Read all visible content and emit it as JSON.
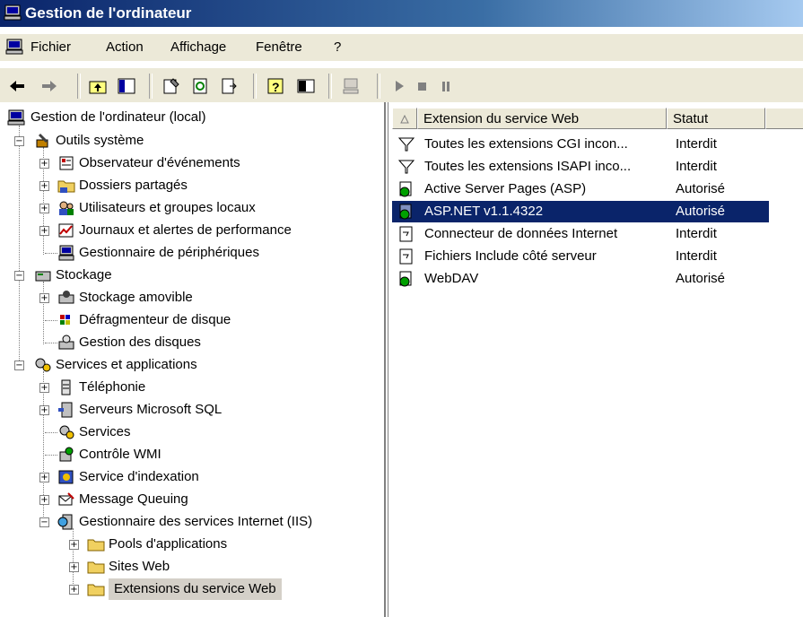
{
  "window": {
    "title": "Gestion de l'ordinateur"
  },
  "menu": [
    {
      "label": "Fichier"
    },
    {
      "label": "Action"
    },
    {
      "label": "Affichage"
    },
    {
      "label": "Fenêtre"
    },
    {
      "label": "?"
    }
  ],
  "tree": {
    "root": "Gestion de l'ordinateur (local)",
    "outils": "Outils système",
    "observateur": "Observateur d'événements",
    "dossiers": "Dossiers partagés",
    "utilisateurs": "Utilisateurs et groupes locaux",
    "journaux": "Journaux et alertes de performance",
    "peripheriques": "Gestionnaire de périphériques",
    "stockage": "Stockage",
    "amovible": "Stockage amovible",
    "defrag": "Défragmenteur de disque",
    "disques": "Gestion des disques",
    "services_apps": "Services et applications",
    "telephonie": "Téléphonie",
    "sql": "Serveurs Microsoft SQL",
    "services": "Services",
    "wmi": "Contrôle WMI",
    "indexation": "Service d'indexation",
    "queuing": "Message Queuing",
    "iis": "Gestionnaire des services Internet (IIS)",
    "pools": "Pools d'applications",
    "sites": "Sites Web",
    "extensions": "Extensions du service Web"
  },
  "list": {
    "columns": [
      "Extension du service Web",
      "Statut"
    ],
    "rows": [
      {
        "name": "Toutes les extensions CGI incon...",
        "status": "Interdit",
        "icon": "filter-icon"
      },
      {
        "name": "Toutes les extensions ISAPI inco...",
        "status": "Interdit",
        "icon": "filter-icon"
      },
      {
        "name": "Active Server Pages (ASP)",
        "status": "Autorisé",
        "icon": "allowed-extension-icon"
      },
      {
        "name": "ASP.NET v1.1.4322",
        "status": "Autorisé",
        "icon": "allowed-extension-icon",
        "selected": true
      },
      {
        "name": "Connecteur de données Internet",
        "status": "Interdit",
        "icon": "prohibited-extension-icon"
      },
      {
        "name": "Fichiers Include côté serveur",
        "status": "Interdit",
        "icon": "prohibited-extension-icon"
      },
      {
        "name": "WebDAV",
        "status": "Autorisé",
        "icon": "allowed-extension-icon"
      }
    ]
  },
  "colors": {
    "title_start": "#0a246a",
    "title_end": "#a6caf0",
    "selection": "#0a246a",
    "chrome": "#ece9d8"
  }
}
